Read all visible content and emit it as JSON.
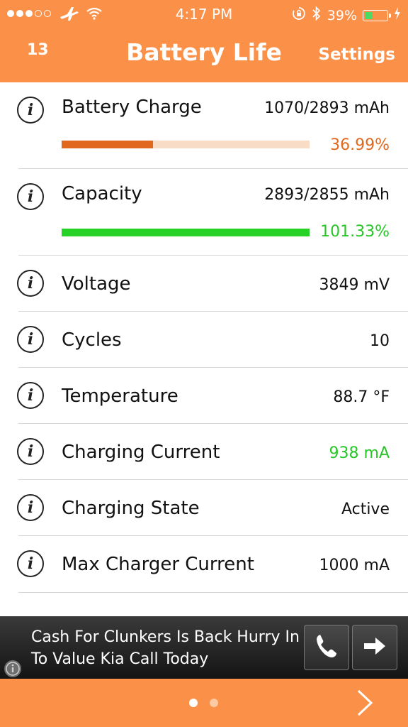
{
  "status_bar": {
    "time": "4:17 PM",
    "battery_percent": "39%",
    "battery_level": 0.39
  },
  "nav": {
    "left": "13",
    "title": "Battery Life",
    "right": "Settings"
  },
  "rows": [
    {
      "label": "Battery Charge",
      "value": "1070/2893 mAh",
      "percent": "36.99%",
      "fraction": 0.3699,
      "bar_color": "#e0691f",
      "track_color": "#f8dcc6",
      "pct_color": "#e0691f"
    },
    {
      "label": "Capacity",
      "value": "2893/2855 mAh",
      "percent": "101.33%",
      "fraction": 1.0,
      "bar_color": "#27d227",
      "track_color": "#cdf3cd",
      "pct_color": "#27c627"
    },
    {
      "label": "Voltage",
      "value": "3849 mV"
    },
    {
      "label": "Cycles",
      "value": "10"
    },
    {
      "label": "Temperature",
      "value": "88.7 °F"
    },
    {
      "label": "Charging Current",
      "value": "938 mA",
      "value_color": "#27c627"
    },
    {
      "label": "Charging State",
      "value": "Active"
    },
    {
      "label": "Max Charger Current",
      "value": "1000 mA"
    }
  ],
  "ad": {
    "text": "Cash For Clunkers Is Back Hurry In To Value Kia Call Today"
  },
  "colors": {
    "accent": "#fb9149"
  }
}
